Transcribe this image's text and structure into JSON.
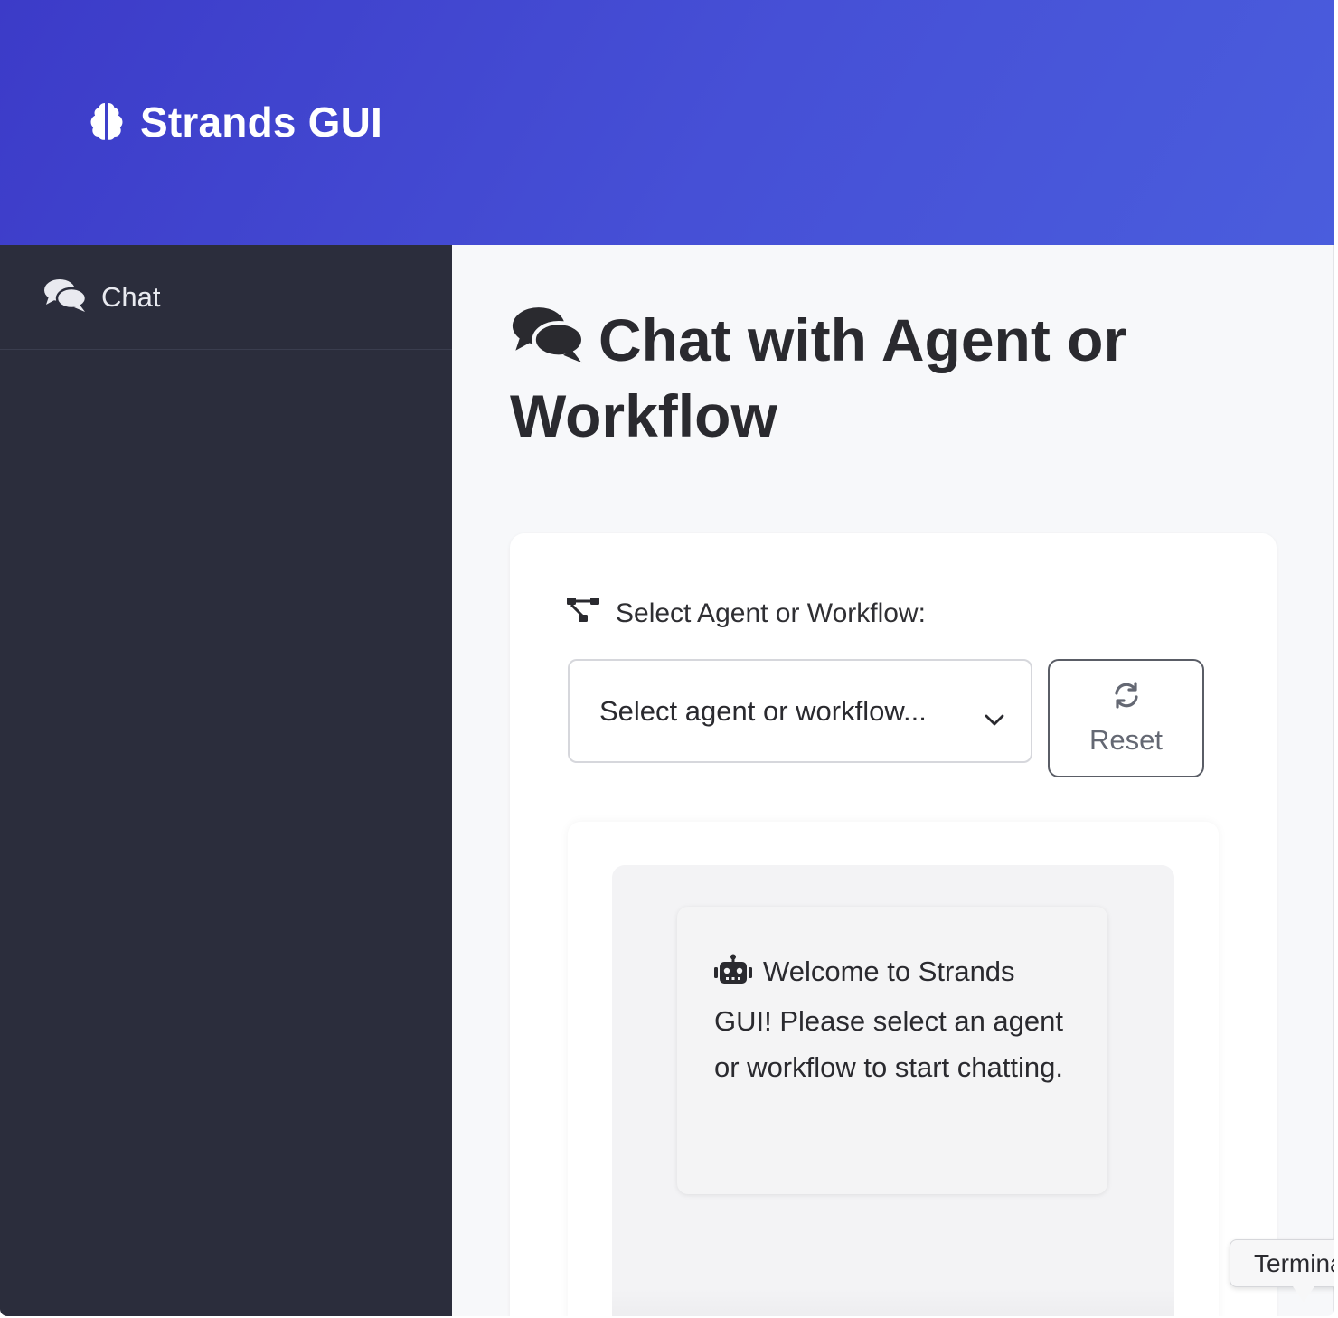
{
  "header": {
    "brand_title": "Strands GUI",
    "brand_icon": "brain-icon",
    "gradient_start": "#3c3bc8",
    "gradient_end": "#4a5ddd"
  },
  "sidebar": {
    "items": [
      {
        "label": "Chat",
        "icon": "comments-icon"
      }
    ]
  },
  "main": {
    "title": "Chat with Agent or Workflow",
    "title_icon": "comments-icon",
    "selector": {
      "label": "Select Agent or Workflow:",
      "label_icon": "sitemap-icon",
      "selected_value": "Select agent or workflow...",
      "reset_label": "Reset",
      "reset_icon": "refresh-icon"
    },
    "messages": [
      {
        "icon": "robot-icon",
        "text": "Welcome to Strands GUI! Please select an agent or workflow to start chatting."
      }
    ]
  },
  "tooltip": {
    "text": "Terminal"
  },
  "colors": {
    "sidebar_bg": "#2b2d3c",
    "main_bg": "#f7f8fa"
  }
}
